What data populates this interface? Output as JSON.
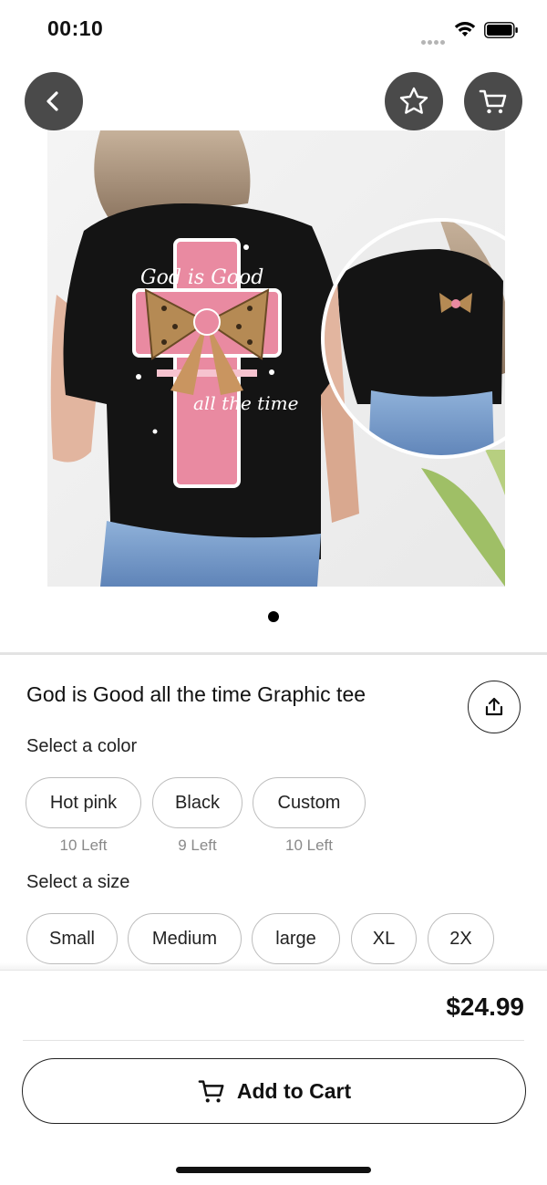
{
  "status_bar": {
    "time": "00:10"
  },
  "nav": {
    "back_icon": "chevron-left-icon",
    "favorite_icon": "star-icon",
    "cart_icon": "cart-icon"
  },
  "product": {
    "image_alt": "Black graphic tee with leopard bow cross print",
    "print_text_top": "God is Good",
    "print_text_bottom": "all the time",
    "title": "God is Good all the time Graphic tee",
    "price": "$24.99"
  },
  "color_section": {
    "label": "Select a color",
    "options": [
      {
        "label": "Hot pink",
        "stock": "10 Left"
      },
      {
        "label": "Black",
        "stock": "9 Left"
      },
      {
        "label": "Custom",
        "stock": "10 Left"
      }
    ]
  },
  "size_section": {
    "label": "Select a size",
    "options": [
      "Small",
      "Medium",
      "large",
      "XL",
      "2X"
    ]
  },
  "actions": {
    "add_to_cart": "Add to Cart"
  },
  "colors": {
    "nav_button_bg": "#4a4a4a",
    "shirt": "#141414",
    "accent_pink": "#e98aa1"
  }
}
